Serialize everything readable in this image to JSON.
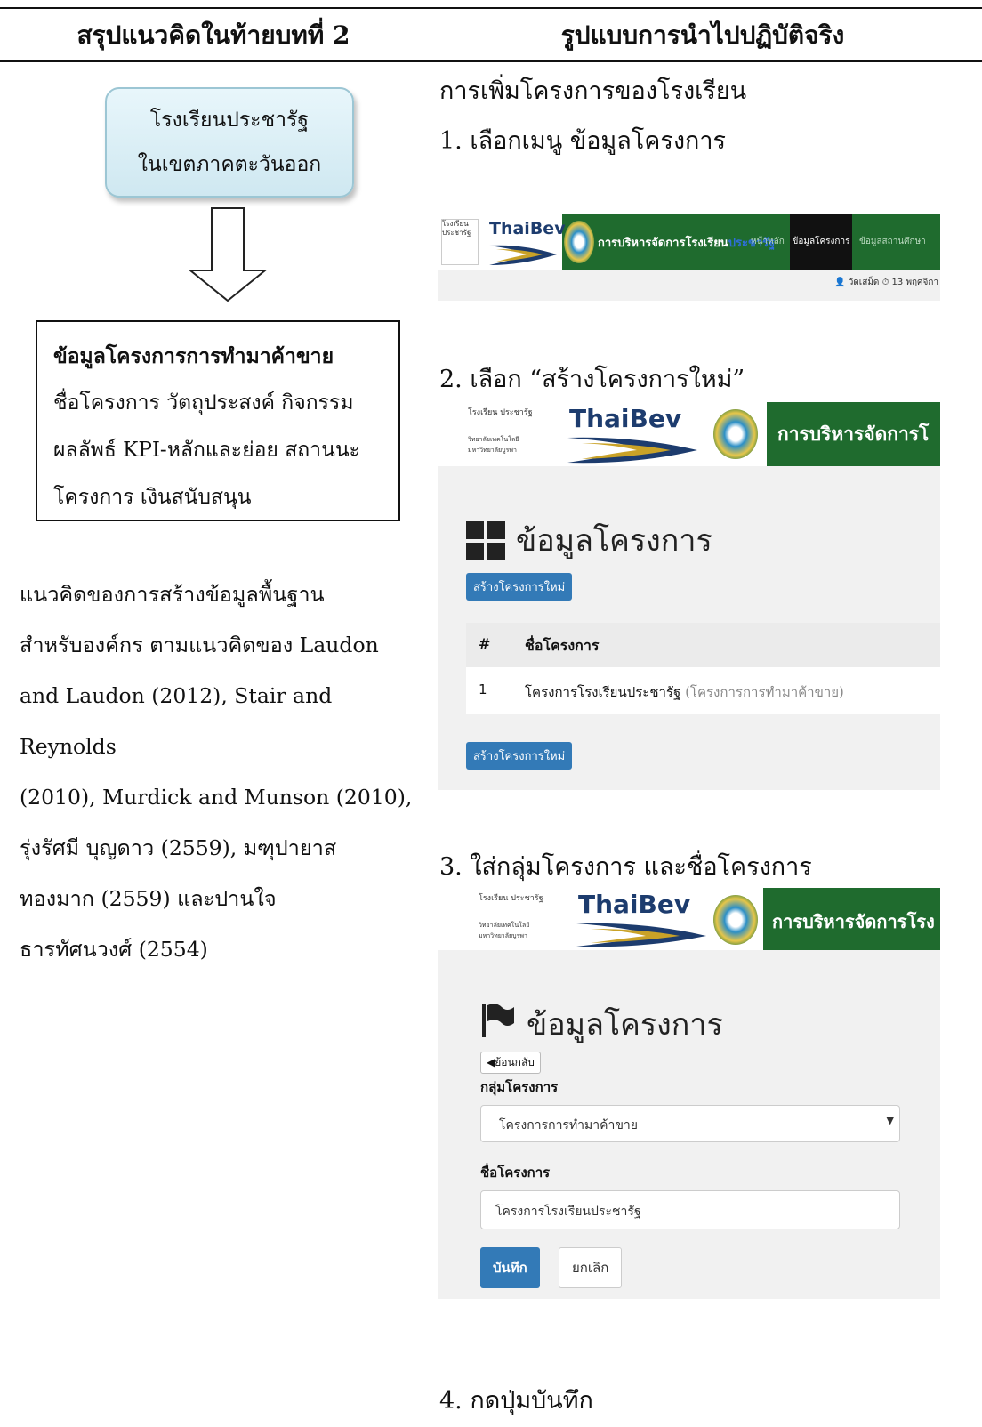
{
  "header": {
    "left_title": "สรุปแนวคิดในท้ายบทที่ 2",
    "right_title": "รูปแบบการนำไปปฏิบัติจริง"
  },
  "flow": {
    "box_line1": "โรงเรียนประชารัฐ",
    "box_line2": "ในเขตภาคตะวันออก"
  },
  "info_box": {
    "title": "ข้อมูลโครงการการทำมาค้าขาย",
    "line1": "ชื่อโครงการ วัตถุประสงค์  กิจกรรม",
    "line2": "ผลลัพธ์ KPI-หลักและย่อย สถานนะ",
    "line3": "โครงการ เงินสนับสนุน"
  },
  "concept": {
    "lines": [
      "แนวคิดของการสร้างข้อมูลพื้นฐาน",
      "สำหรับองค์กร ตามแนวคิดของ Laudon",
      "and Laudon (2012), Stair and Reynolds",
      "(2010), Murdick and Munson (2010),",
      "รุ่งรัศมี บุญดาว (2559), มฑุปายาส",
      "ทองมาก (2559) และปานใจ",
      "ธารทัศนวงศ์ (2554)"
    ]
  },
  "steps": {
    "intro": "การเพิ่มโครงการของโรงเรียน",
    "step1": "1. เลือกเมนู ข้อมูลโครงการ",
    "step2": "2. เลือก “สร้างโครงการใหม่”",
    "step3": "3. ใส่กลุ่มโครงการ และชื่อโครงการ",
    "step4": "4. กดปุ่มบันทึก"
  },
  "shot1": {
    "brand": "การบริหารจัดการโรงเรียน",
    "brand_highlight": "ประชารัฐ",
    "nav_home": "หน้าหลัก",
    "nav_projects": "ข้อมูลโครงการ",
    "nav_school": "ข้อมูลสถานศึกษา",
    "user_line": "วัดเสม็ด ⏱ 13 พฤศจิกา",
    "logo_school": "โรงเรียน ประชารัฐ",
    "logo_thaibev": "ThaiBev"
  },
  "shot2": {
    "brand": "การบริหารจัดการโ",
    "logo_thaibev": "ThaiBev",
    "logo_school": "โรงเรียน ประชารัฐ",
    "logo_sub": "วิทยาลัยเทคโนโลยี มหาวิทยาลัยบูรพา",
    "heading": "ข้อมูลโครงการ",
    "create_button": "สร้างโครงการใหม่",
    "table_headers": [
      "#",
      "ชื่อโครงการ"
    ],
    "table_rows": [
      {
        "num": "1",
        "name": "โครงการโรงเรียนประชารัฐ",
        "group": "(โครงการการทำมาค้าขาย)"
      }
    ]
  },
  "shot3": {
    "brand": "การบริหารจัดการโรง",
    "logo_thaibev": "ThaiBev",
    "logo_school": "โรงเรียน ประชารัฐ",
    "logo_sub": "วิทยาลัยเทคโนโลยี มหาวิทยาลัยบูรพา",
    "heading": "ข้อมูลโครงการ",
    "back_button": "ย้อนกลับ",
    "group_label": "กลุ่มโครงการ",
    "group_value": "โครงการการทำมาค้าขาย",
    "name_label": "ชื่อโครงการ",
    "name_value": "โครงการโรงเรียนประชารัฐ",
    "save_button": "บันทึก",
    "cancel_button": "ยกเลิก"
  },
  "colors": {
    "green_bar": "#1f6b2e",
    "primary": "#337ab7",
    "flow_box": "#d4ebf3"
  }
}
